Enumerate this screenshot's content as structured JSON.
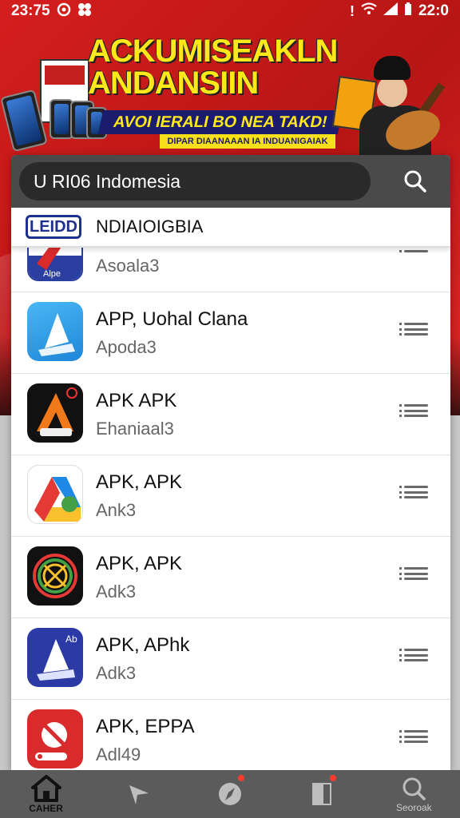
{
  "status_bar": {
    "time_left": "23:75",
    "time_right": "22:0"
  },
  "banner": {
    "headline_line1": "ACKUMISEAKLN",
    "headline_line2": "ANDANSIIN",
    "subline": "AVOI IERALI BO NEA TAKD!",
    "tagline": "DIPAR DIAANAAAN IA INDUANIGAIAK"
  },
  "search": {
    "value": "U RI06 Indomesia"
  },
  "region": {
    "badge": "LEIDD",
    "label": "NDIAIOIGBIA"
  },
  "apps": [
    {
      "name": "",
      "sub": "Asoala3",
      "icon": "arrow-app-icon",
      "color": "#2a3fa0"
    },
    {
      "name": "APP, Uohal Clana",
      "sub": "Apoda3",
      "icon": "triangle-app-icon",
      "color": "#2e9ee6"
    },
    {
      "name": "APK APK",
      "sub": "Ehaniaal3",
      "icon": "tool-app-icon",
      "color": "#111111"
    },
    {
      "name": "APK, APK",
      "sub": "Ank3",
      "icon": "drive-app-icon",
      "color": "#ffffff"
    },
    {
      "name": "APK, APK",
      "sub": "Adk3",
      "icon": "wheel-app-icon",
      "color": "#111111"
    },
    {
      "name": "APK, APhk",
      "sub": "Adk3",
      "icon": "triangle-app-icon",
      "color": "#2b3aa5"
    },
    {
      "name": "APK, EPPA",
      "sub": "Adl49",
      "icon": "wrench-app-icon",
      "color": "#d92b2b"
    }
  ],
  "nav": {
    "home_label": "CAHER",
    "search_label": "Seoroak"
  }
}
